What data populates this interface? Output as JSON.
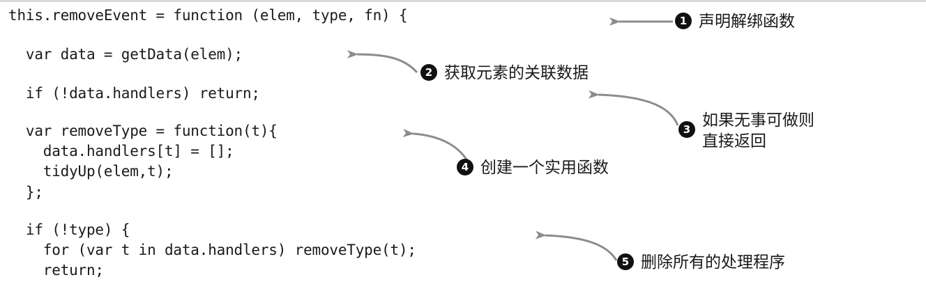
{
  "code_lines": [
    "this.removeEvent = function (elem, type, fn) {",
    "  var data = getData(elem);",
    "  if (!data.handlers) return;",
    "  var removeType = function(t){",
    "    data.handlers[t] = [];",
    "    tidyUp(elem,t);",
    "  };",
    "  if (!type) {",
    "    for (var t in data.handlers) removeType(t);",
    "    return;"
  ],
  "annotations": [
    {
      "number": "1",
      "text": "声明解绑函数"
    },
    {
      "number": "2",
      "text": "获取元素的关联数据"
    },
    {
      "number": "3",
      "text": "如果无事可做则\n直接返回"
    },
    {
      "number": "4",
      "text": "创建一个实用函数"
    },
    {
      "number": "5",
      "text": "删除所有的处理程序"
    }
  ],
  "colors": {
    "arrow": "#8c8c8c",
    "badge": "#111111",
    "text": "#1a1a1a"
  }
}
